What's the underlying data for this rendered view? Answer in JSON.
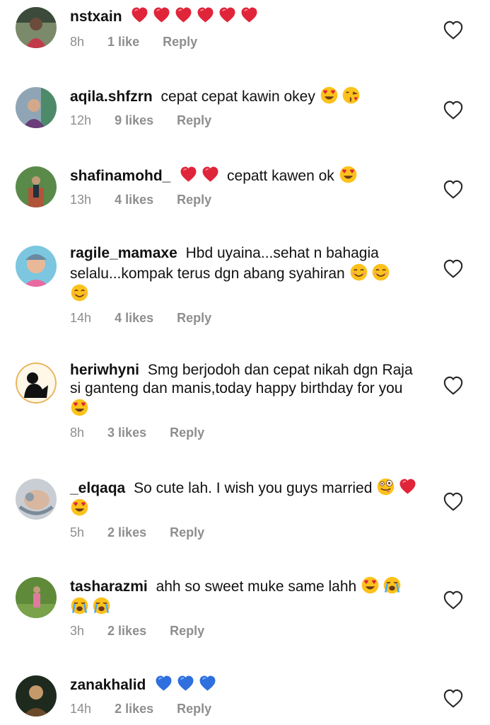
{
  "comments": [
    {
      "username": "nstxain",
      "text": "",
      "emojis": [
        "heart",
        "heart",
        "heart",
        "heart",
        "heart",
        "heart"
      ],
      "time": "8h",
      "likes": "1 like",
      "reply": "Reply"
    },
    {
      "username": "aqila.shfzrn",
      "text": "cepat cepat kawin okey",
      "emojis": [
        "heart-eyes",
        "kiss"
      ],
      "time": "12h",
      "likes": "9 likes",
      "reply": "Reply"
    },
    {
      "username": "shafinamohd_",
      "text": "cepatt kawen ok",
      "emojis": [
        "heart",
        "heart",
        "heart-eyes"
      ],
      "time": "13h",
      "likes": "4 likes",
      "reply": "Reply"
    },
    {
      "username": "ragile_mamaxe",
      "text": "Hbd uyaina...sehat n bahagia selalu...kompak terus dgn abang syahiran",
      "emojis": [
        "smile",
        "smile",
        "smile"
      ],
      "time": "14h",
      "likes": "4 likes",
      "reply": "Reply"
    },
    {
      "username": "heriwhyni",
      "text": "Smg berjodoh dan cepat nikah dgn Raja si ganteng dan manis,today happy birthday for you",
      "emojis": [
        "heart-eyes"
      ],
      "time": "8h",
      "likes": "3 likes",
      "reply": "Reply"
    },
    {
      "username": "_elqaqa",
      "text": "So cute lah. I wish you guys married",
      "emojis": [
        "zany",
        "heart",
        "heart-eyes"
      ],
      "time": "5h",
      "likes": "2 likes",
      "reply": "Reply"
    },
    {
      "username": "tasharazmi",
      "text": "ahh so sweet muke same lahh",
      "emojis": [
        "heart-eyes",
        "crying",
        "crying",
        "crying"
      ],
      "time": "3h",
      "likes": "2 likes",
      "reply": "Reply"
    },
    {
      "username": "zanakhalid",
      "text": "",
      "emojis": [
        "blue-heart",
        "blue-heart",
        "blue-heart"
      ],
      "time": "14h",
      "likes": "2 likes",
      "reply": "Reply"
    }
  ],
  "colors": {
    "meta_gray": "#8e8e8e",
    "heart_red": "#e0253a",
    "heart_blue": "#2f6fde",
    "emoji_yellow": "#fcc21b"
  }
}
